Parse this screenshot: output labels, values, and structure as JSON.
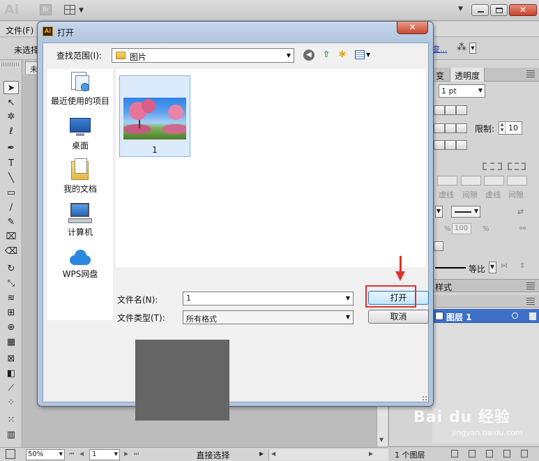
{
  "app": {
    "logo_text": "Ai",
    "bridge_label": "Br",
    "menu_file": "文件(F)",
    "control_text": "未选择",
    "doc_tab": "未",
    "control_link": "变...",
    "close_glyph": "✕"
  },
  "dialog": {
    "app_icon": "Ai",
    "title": "打开",
    "close_glyph": "✕",
    "look_in_label": "查找范围(I):",
    "look_in_value": "图片",
    "places": [
      {
        "label": "最近使用的项目",
        "icon": "recent-items-icon"
      },
      {
        "label": "桌面",
        "icon": "desktop-icon"
      },
      {
        "label": "我的文档",
        "icon": "documents-icon"
      },
      {
        "label": "计算机",
        "icon": "computer-icon"
      },
      {
        "label": "WPS网盘",
        "icon": "cloud-icon"
      }
    ],
    "files": [
      {
        "name": "1"
      }
    ],
    "file_name_label": "文件名(N):",
    "file_name_value": "1",
    "file_type_label": "文件类型(T):",
    "file_type_value": "所有格式",
    "open_button": "打开",
    "cancel_button": "取消",
    "annotation_color": "#e0302b"
  },
  "panels": {
    "tab_partial": "变",
    "tab_transparency": "透明度",
    "stroke_weight": "1 pt",
    "limit_label": "限制:",
    "limit_value": "10",
    "dash_label": "虚线",
    "gap_label": "间隙",
    "scale_value": "100",
    "percent": "%",
    "profile_label": "等比",
    "layers_tab": "样式",
    "layer_name": "图层 1",
    "layer_color": "#3f70c8",
    "layers_count": "1 个图层"
  },
  "statusbar": {
    "zoom": "50%",
    "page": "1",
    "tool_status": "直接选择"
  },
  "watermark": {
    "brand": "Bai du 经验",
    "url": "jingyan.baidu.com"
  }
}
